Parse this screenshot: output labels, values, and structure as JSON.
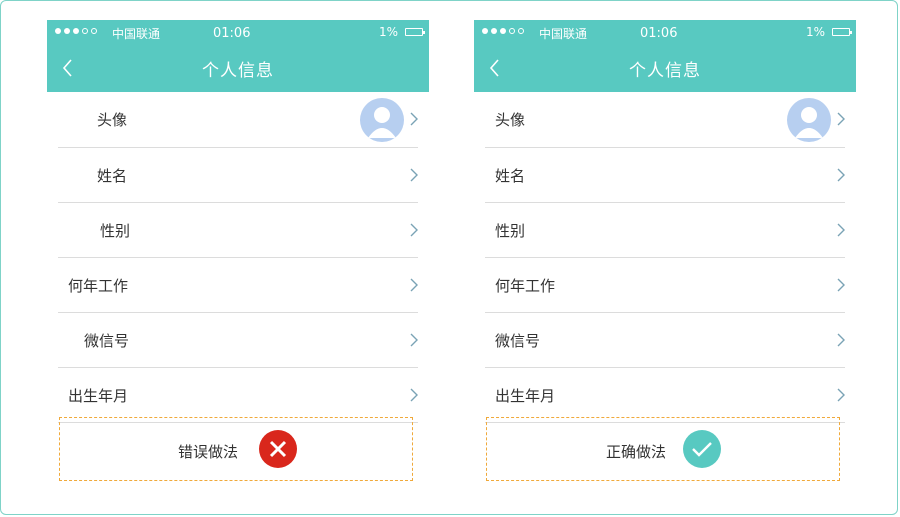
{
  "colors": {
    "teal": "#58c9c1",
    "error_red": "#d9271c",
    "dashed_orange": "#f0a93a",
    "avatar_blue": "#b7cff0"
  },
  "phones": [
    {
      "status": {
        "carrier": "中国联通",
        "time": "01:06",
        "battery": "1%"
      },
      "nav": {
        "title": "个人信息",
        "back_icon": "chevron-left-icon"
      },
      "rows": [
        {
          "label": "头像",
          "has_avatar": true
        },
        {
          "label": "姓名"
        },
        {
          "label": "性别"
        },
        {
          "label": "何年工作"
        },
        {
          "label": "微信号"
        },
        {
          "label": "出生年月"
        }
      ],
      "verdict": {
        "label": "错误做法",
        "icon": "error-x-icon"
      }
    },
    {
      "status": {
        "carrier": "中国联通",
        "time": "01:06",
        "battery": "1%"
      },
      "nav": {
        "title": "个人信息",
        "back_icon": "chevron-left-icon"
      },
      "rows": [
        {
          "label": "头像",
          "has_avatar": true
        },
        {
          "label": "姓名"
        },
        {
          "label": "性别"
        },
        {
          "label": "何年工作"
        },
        {
          "label": "微信号"
        },
        {
          "label": "出生年月"
        }
      ],
      "verdict": {
        "label": "正确做法",
        "icon": "check-icon"
      }
    }
  ]
}
